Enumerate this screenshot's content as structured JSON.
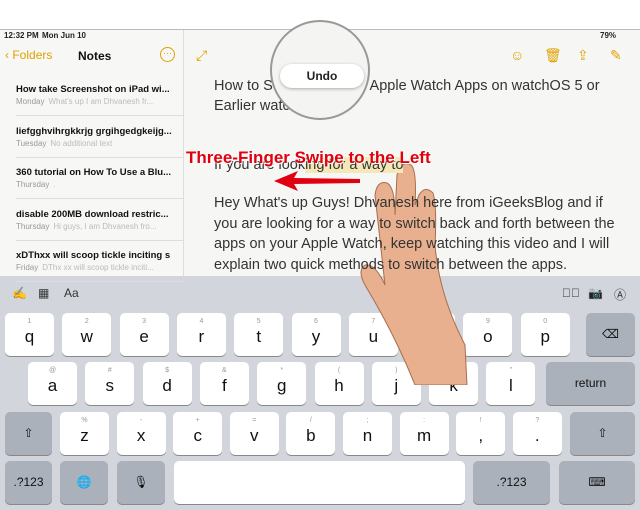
{
  "status": {
    "time": "12:32 PM",
    "date": "Mon Jun 10",
    "battery": "79%"
  },
  "sidebar": {
    "back": "Folders",
    "title": "Notes",
    "notes": [
      {
        "title": "How take Screenshot on iPad wi...",
        "date": "Monday",
        "preview": "What's up I am Dhvanesh fr..."
      },
      {
        "title": "liefgghvihrgkkrjg grgihgedgkeijg...",
        "date": "Tuesday",
        "preview": "No additional text"
      },
      {
        "title": "360 tutorial on How To Use a Blu...",
        "date": "Thursday",
        "preview": "."
      },
      {
        "title": "disable 200MB download restric...",
        "date": "Thursday",
        "preview": "Hi guys, I am Dhvanesh fro..."
      },
      {
        "title": "xDThxx will scoop tickle inciting s",
        "date": "Friday",
        "preview": "DThx xx will scoop tickle inciti..."
      }
    ]
  },
  "note": {
    "line1": "How to Switch Between Apple Watch Apps on watchOS 5 or",
    "line2": "Earlier watchOS",
    "sel_pre": "If you are look",
    "sel": "ing for a way to",
    "para": "Hey What's up Guys! Dhvanesh here from iGeeksBlog and if you are looking for a way to switch back and forth between the apps on your Apple Watch, keep watching this video and I will explain two quick methods to switch between the apps."
  },
  "undo": "Undo",
  "annotation": "Three-Finger Swipe to the Left",
  "accent": "#e0a100",
  "annotation_color": "#e00010",
  "toolbar": {
    "aa": "Aa"
  },
  "keyboard": {
    "row1": [
      [
        "1",
        "q"
      ],
      [
        "2",
        "w"
      ],
      [
        "3",
        "e"
      ],
      [
        "4",
        "r"
      ],
      [
        "5",
        "t"
      ],
      [
        "6",
        "y"
      ],
      [
        "7",
        "u"
      ],
      [
        "8",
        "i"
      ],
      [
        "9",
        "o"
      ],
      [
        "0",
        "p"
      ]
    ],
    "row2": [
      [
        "@",
        "a"
      ],
      [
        "#",
        "s"
      ],
      [
        "$",
        "d"
      ],
      [
        "&",
        "f"
      ],
      [
        "*",
        "g"
      ],
      [
        "(",
        "h"
      ],
      [
        ")",
        "j"
      ],
      [
        "'",
        "k"
      ],
      [
        "\"",
        "l"
      ]
    ],
    "row3": [
      [
        "%",
        "z"
      ],
      [
        "-",
        "x"
      ],
      [
        "+",
        "c"
      ],
      [
        "=",
        "v"
      ],
      [
        "/",
        "b"
      ],
      [
        ";",
        "n"
      ],
      [
        ":",
        "m"
      ],
      [
        "!",
        ","
      ],
      [
        "?",
        "."
      ]
    ],
    "return": "return",
    "numbers": ".?123"
  }
}
